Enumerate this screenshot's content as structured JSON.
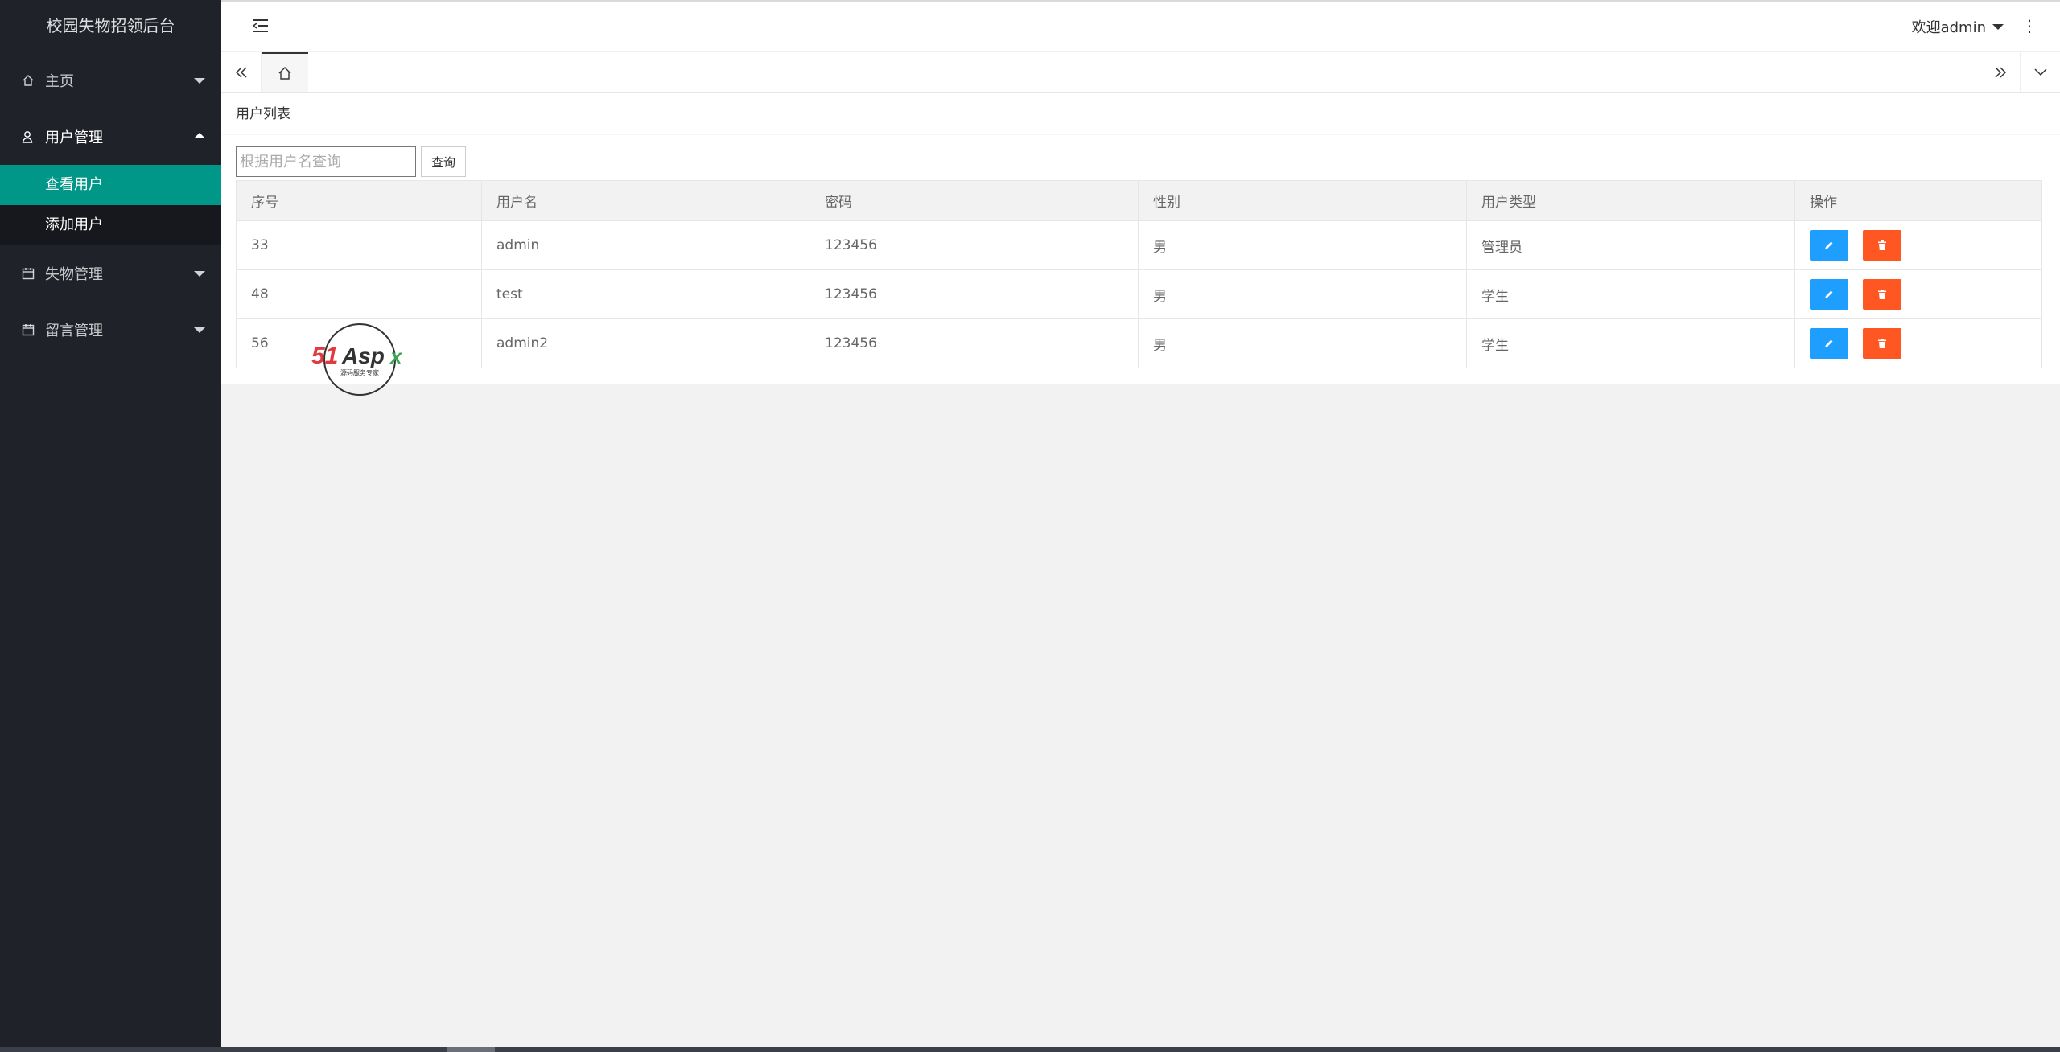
{
  "sidebar": {
    "title": "校园失物招领后台",
    "items": [
      {
        "label": "主页",
        "icon": "home-icon",
        "expanded": false
      },
      {
        "label": "用户管理",
        "icon": "user-icon",
        "expanded": true,
        "children": [
          {
            "label": "查看用户",
            "active": true
          },
          {
            "label": "添加用户",
            "active": false
          }
        ]
      },
      {
        "label": "失物管理",
        "icon": "calendar-icon",
        "expanded": false
      },
      {
        "label": "留言管理",
        "icon": "calendar-icon",
        "expanded": false
      }
    ]
  },
  "header": {
    "welcome": "欢迎admin"
  },
  "main": {
    "card_title": "用户列表",
    "search": {
      "placeholder": "根据用户名查询",
      "value": "",
      "button": "查询"
    },
    "table": {
      "columns": [
        "序号",
        "用户名",
        "密码",
        "性别",
        "用户类型",
        "操作"
      ],
      "rows": [
        [
          "33",
          "admin",
          "123456",
          "男",
          "管理员"
        ],
        [
          "48",
          "test",
          "123456",
          "男",
          "学生"
        ],
        [
          "56",
          "admin2",
          "123456",
          "男",
          "学生"
        ]
      ]
    }
  },
  "watermark": {
    "text": "51Aspx",
    "subtext": "源码服务专家"
  },
  "colors": {
    "sidebar_bg": "#20222a",
    "active_item": "#009688",
    "edit_button": "#1e9fff",
    "delete_button": "#ff5722"
  }
}
